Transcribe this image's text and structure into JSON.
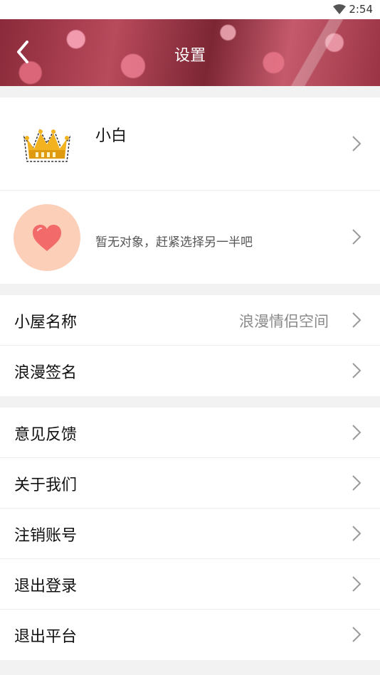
{
  "status_bar": {
    "time": "2:54"
  },
  "header": {
    "title": "设置"
  },
  "profile": {
    "name": "小白"
  },
  "partner": {
    "text": "暂无对象，赶紧选择另一半吧"
  },
  "section1": {
    "house_name_label": "小屋名称",
    "house_name_value": "浪漫情侣空间",
    "signature_label": "浪漫签名"
  },
  "section2": {
    "items": [
      "意见反馈",
      "关于我们",
      "注销账号",
      "退出登录",
      "退出平台"
    ]
  },
  "colors": {
    "heart": "#f26a6a",
    "heart_bg": "#fccfb8",
    "header": "#9a3444"
  },
  "icons": {
    "back": "chevron-left-icon",
    "row_arrow": "chevron-right-icon",
    "crown": "crown-icon",
    "heart": "heart-icon",
    "wifi": "wifi-icon"
  }
}
